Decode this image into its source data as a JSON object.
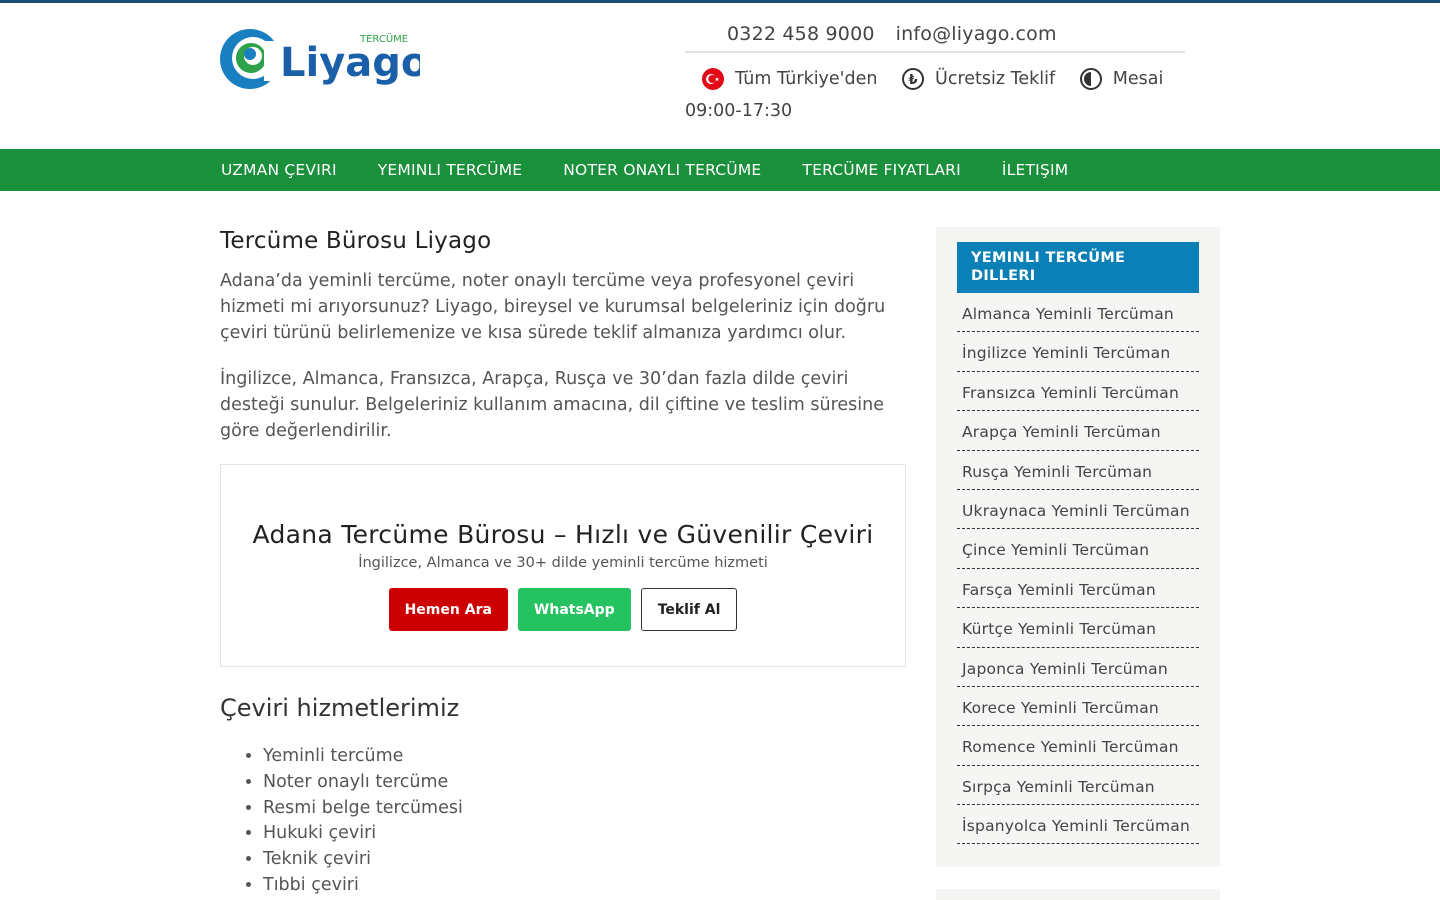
{
  "header": {
    "logo": {
      "brand": "Liyago",
      "tag": "TERCÜME"
    },
    "phone": "0322 458 9000",
    "email": "info@liyago.com",
    "features": [
      {
        "icon": "turkey-flag-icon",
        "label": "Tüm Türkiye'den"
      },
      {
        "icon": "lira-coin-icon",
        "label": "Ücretsiz Teklif"
      },
      {
        "icon": "clock-icon",
        "label": "Mesai"
      }
    ],
    "hours": "09:00-17:30"
  },
  "nav": {
    "items": [
      "UZMAN ÇEVIRI",
      "YEMINLI TERCÜME",
      "NOTER ONAYLI TERCÜME",
      "TERCÜME FIYATLARI",
      "İLETIŞIM"
    ]
  },
  "main": {
    "title": "Tercüme Bürosu Liyago",
    "paragraphs": [
      "Adana’da yeminli tercüme, noter onaylı tercüme veya profesyonel çeviri hizmeti mi arıyorsunuz? Liyago, bireysel ve kurumsal belgeleriniz için doğru çeviri türünü belirlemenize ve kısa sürede teklif almanıza yardımcı olur.",
      "İngilizce, Almanca, Fransızca, Arapça, Rusça ve 30’dan fazla dilde çeviri desteği sunulur. Belgeleriniz kullanım amacına, dil çiftine ve teslim süresine göre değerlendirilir."
    ],
    "cta": {
      "title": "Adana Tercüme Bürosu – Hızlı ve Güvenilir Çeviri",
      "subtitle": "İngilizce, Almanca ve 30+ dilde yeminli tercüme hizmeti",
      "call_label": "Hemen Ara",
      "whatsapp_label": "WhatsApp",
      "quote_label": "Teklif Al"
    },
    "services_heading": "Çeviri hizmetlerimiz",
    "services": [
      "Yeminli tercüme",
      "Noter onaylı tercüme",
      "Resmi belge tercümesi",
      "Hukuki çeviri",
      "Teknik çeviri",
      "Tıbbi çeviri"
    ]
  },
  "sidebar": {
    "title": "YEMINLI TERCÜME DILLERI",
    "items": [
      "Almanca Yeminli Tercüman",
      "İngilizce Yeminli Tercüman",
      "Fransızca Yeminli Tercüman",
      "Arapça Yeminli Tercüman",
      "Rusça Yeminli Tercüman",
      "Ukraynaca Yeminli Tercüman",
      "Çince Yeminli Tercüman",
      "Farsça Yeminli Tercüman",
      "Kürtçe Yeminli Tercüman",
      "Japonca Yeminli Tercüman",
      "Korece Yeminli Tercüman",
      "Romence Yeminli Tercüman",
      "Sırpça Yeminli Tercüman",
      "İspanyolca Yeminli Tercüman"
    ]
  },
  "colors": {
    "nav_green": "#1a8f3c",
    "sidebar_blue": "#0a80b7",
    "call_red": "#cc0000",
    "whatsapp_green": "#25c261",
    "top_border": "#1a4d73"
  }
}
